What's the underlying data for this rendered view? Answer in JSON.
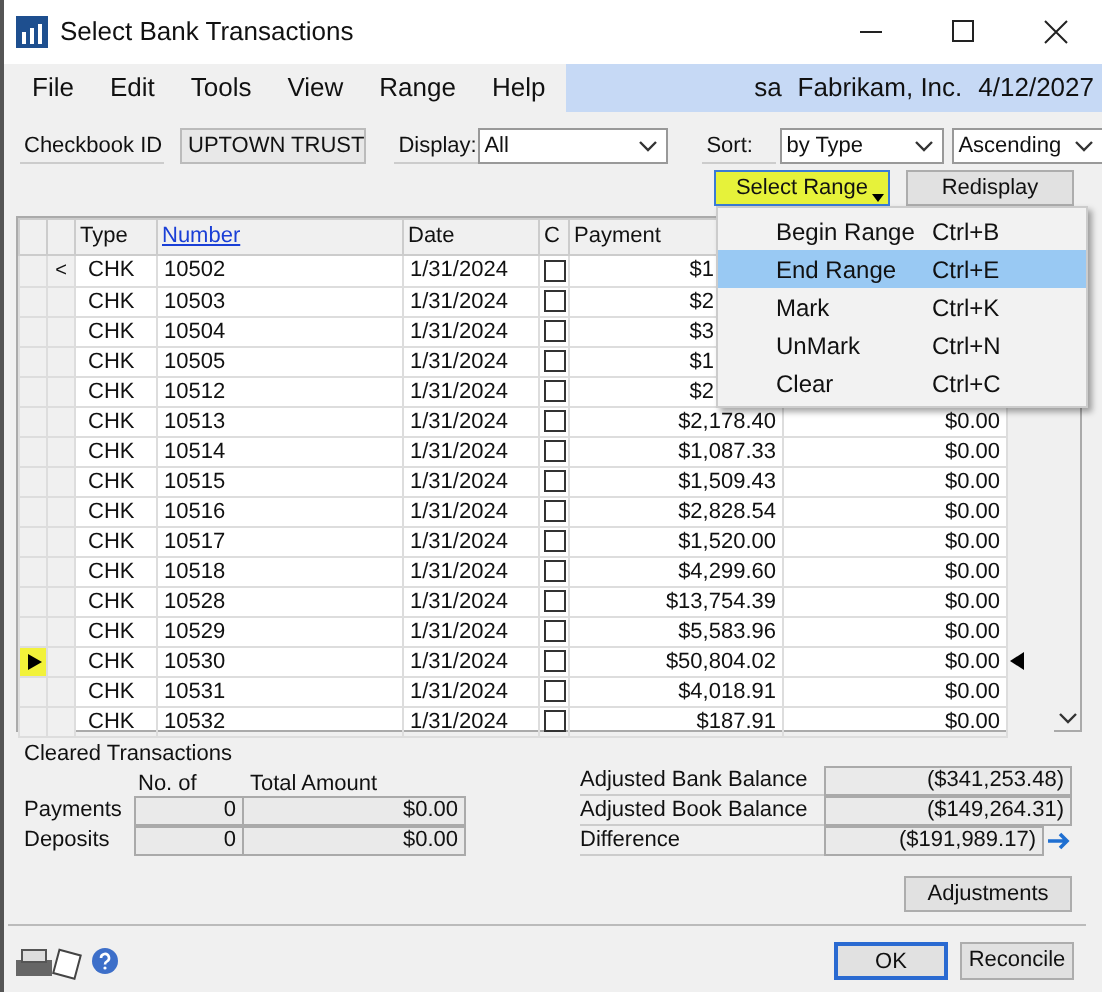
{
  "window": {
    "title": "Select Bank Transactions"
  },
  "menu": [
    "File",
    "Edit",
    "Tools",
    "View",
    "Range",
    "Help"
  ],
  "user_info": {
    "user": "sa",
    "company": "Fabrikam, Inc.",
    "date": "4/12/2027"
  },
  "checkbook": {
    "label": "Checkbook ID",
    "value": "UPTOWN TRUST"
  },
  "display": {
    "label": "Display:",
    "value": "All"
  },
  "sort": {
    "label": "Sort:",
    "value": "by Type",
    "order": "Ascending"
  },
  "buttons": [
    {
      "label": "Select Range",
      "kind": "dropdown",
      "highlighted": true
    },
    {
      "label": "Redisplay",
      "kind": "plain",
      "highlighted": false
    }
  ],
  "columns": [
    {
      "label": "Type",
      "sorted": false
    },
    {
      "label": "Number",
      "sorted": true
    },
    {
      "label": "Date",
      "sorted": false
    },
    {
      "label": "C",
      "sorted": false
    },
    {
      "label": "Payment",
      "sorted": false
    }
  ],
  "rows": [
    {
      "marker": "<",
      "type": "CHK",
      "number": "10502",
      "date": "1/31/2024",
      "cleared": false,
      "payment": "$1",
      "selected": false
    },
    {
      "type": "CHK",
      "number": "10503",
      "date": "1/31/2024",
      "cleared": false,
      "payment": "$2",
      "selected": false
    },
    {
      "type": "CHK",
      "number": "10504",
      "date": "1/31/2024",
      "cleared": false,
      "payment": "$3",
      "selected": false
    },
    {
      "type": "CHK",
      "number": "10505",
      "date": "1/31/2024",
      "cleared": false,
      "payment": "$1",
      "selected": false
    },
    {
      "type": "CHK",
      "number": "10512",
      "date": "1/31/2024",
      "cleared": false,
      "payment": "$2",
      "selected": false
    },
    {
      "type": "CHK",
      "number": "10513",
      "date": "1/31/2024",
      "cleared": false,
      "payment": "$2,178.40",
      "deposit": "$0.00",
      "selected": false
    },
    {
      "type": "CHK",
      "number": "10514",
      "date": "1/31/2024",
      "cleared": false,
      "payment": "$1,087.33",
      "deposit": "$0.00",
      "selected": false
    },
    {
      "type": "CHK",
      "number": "10515",
      "date": "1/31/2024",
      "cleared": false,
      "payment": "$1,509.43",
      "deposit": "$0.00",
      "selected": false
    },
    {
      "type": "CHK",
      "number": "10516",
      "date": "1/31/2024",
      "cleared": false,
      "payment": "$2,828.54",
      "deposit": "$0.00",
      "selected": false
    },
    {
      "type": "CHK",
      "number": "10517",
      "date": "1/31/2024",
      "cleared": false,
      "payment": "$1,520.00",
      "deposit": "$0.00",
      "selected": false
    },
    {
      "type": "CHK",
      "number": "10518",
      "date": "1/31/2024",
      "cleared": false,
      "payment": "$4,299.60",
      "deposit": "$0.00",
      "selected": false
    },
    {
      "type": "CHK",
      "number": "10528",
      "date": "1/31/2024",
      "cleared": false,
      "payment": "$13,754.39",
      "deposit": "$0.00",
      "selected": false
    },
    {
      "type": "CHK",
      "number": "10529",
      "date": "1/31/2024",
      "cleared": false,
      "payment": "$5,583.96",
      "deposit": "$0.00",
      "selected": false
    },
    {
      "type": "CHK",
      "number": "10530",
      "date": "1/31/2024",
      "cleared": false,
      "payment": "$50,804.02",
      "deposit": "$0.00",
      "selected": true
    },
    {
      "type": "CHK",
      "number": "10531",
      "date": "1/31/2024",
      "cleared": false,
      "payment": "$4,018.91",
      "deposit": "$0.00",
      "selected": false
    },
    {
      "type": "CHK",
      "number": "10532",
      "date": "1/31/2024",
      "cleared": false,
      "payment": "$187.91",
      "deposit": "$0.00",
      "selected": false
    }
  ],
  "range_menu": [
    {
      "label": "Begin Range",
      "shortcut": "Ctrl+B",
      "selected": false
    },
    {
      "label": "End Range",
      "shortcut": "Ctrl+E",
      "selected": true
    },
    {
      "label": "Mark",
      "shortcut": "Ctrl+K",
      "selected": false
    },
    {
      "label": "UnMark",
      "shortcut": "Ctrl+N",
      "selected": false
    },
    {
      "label": "Clear",
      "shortcut": "Ctrl+C",
      "selected": false
    }
  ],
  "cleared": {
    "title": "Cleared Transactions",
    "headers": [
      "No. of",
      "Total Amount"
    ],
    "rows": [
      {
        "label": "Payments",
        "count": "0",
        "amount": "$0.00"
      },
      {
        "label": "Deposits",
        "count": "0",
        "amount": "$0.00"
      }
    ]
  },
  "balances": [
    {
      "label": "Adjusted Bank Balance",
      "value": "($341,253.48)"
    },
    {
      "label": "Adjusted Book Balance",
      "value": "($149,264.31)"
    },
    {
      "label": "Difference",
      "value": "($191,989.17)",
      "kind": "link"
    }
  ],
  "adjustments_button": "Adjustments",
  "footer_buttons": [
    {
      "label": "OK",
      "default": true
    },
    {
      "label": "Reconcile",
      "default": false
    }
  ]
}
